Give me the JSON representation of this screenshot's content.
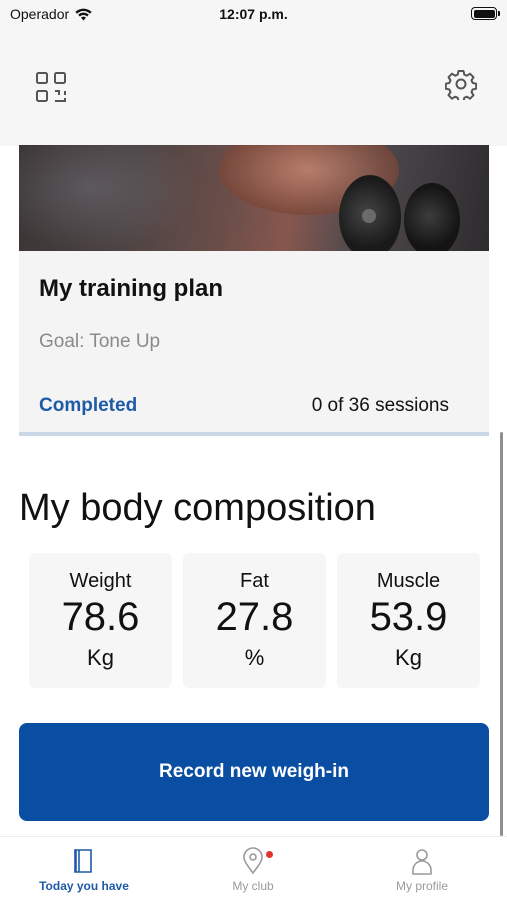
{
  "status_bar": {
    "carrier": "Operador",
    "time": "12:07 p.m."
  },
  "header": {
    "qr_icon": "qr-code-icon",
    "settings_icon": "gear-icon"
  },
  "training_plan": {
    "title": "My training plan",
    "goal": "Goal: Tone Up",
    "status": "Completed",
    "sessions": "0 of 36 sessions",
    "progress_fraction": 0
  },
  "body_composition": {
    "title": "My body composition",
    "metrics": [
      {
        "label": "Weight",
        "value": "78.6",
        "unit": "Kg"
      },
      {
        "label": "Fat",
        "value": "27.8",
        "unit": "%"
      },
      {
        "label": "Muscle",
        "value": "53.9",
        "unit": "Kg"
      }
    ],
    "record_button": "Record new weigh-in"
  },
  "tab_bar": {
    "tabs": [
      {
        "label": "Today you have",
        "icon": "book-icon",
        "active": true
      },
      {
        "label": "My club",
        "icon": "location-pin-icon",
        "active": false
      },
      {
        "label": "My profile",
        "icon": "person-icon",
        "active": false
      }
    ]
  },
  "colors": {
    "accent": "#0a4ea3",
    "link": "#1f5aa8",
    "notification": "#e0342e"
  }
}
